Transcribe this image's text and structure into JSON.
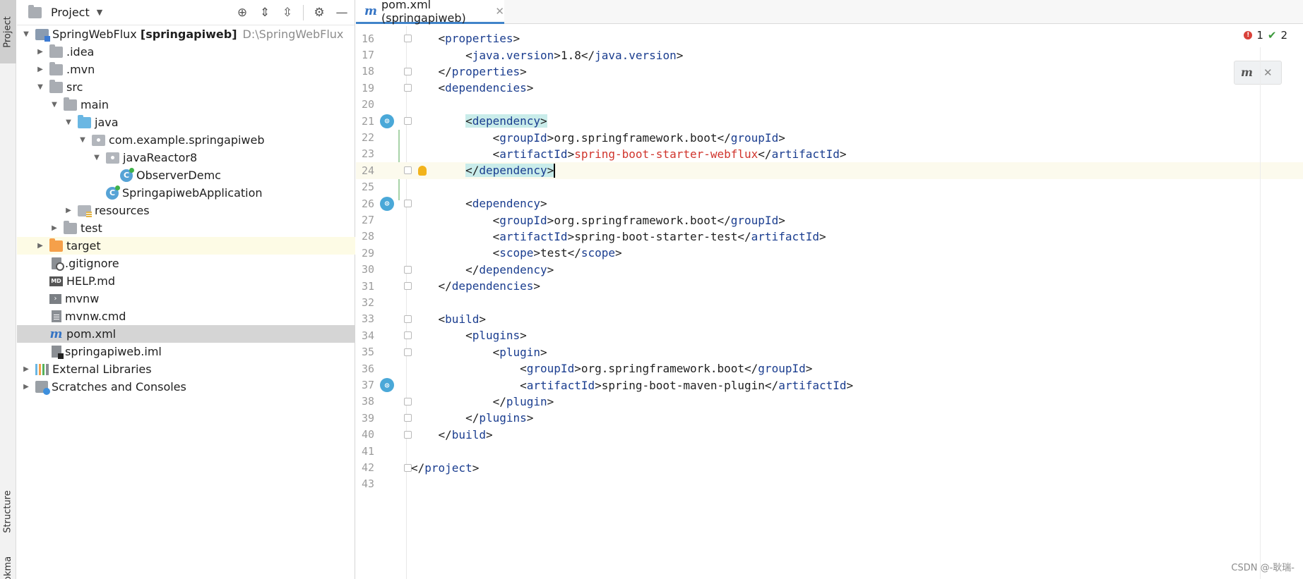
{
  "strip": {
    "project": "Project",
    "structure": "Structure",
    "bookmarks": "Bookmarks"
  },
  "project_panel": {
    "title": "Project",
    "tree": [
      {
        "label": "SpringWebFlux",
        "bold": "[springapiweb]",
        "path": "D:\\SpringWebFlux",
        "icon": "module-icon"
      },
      {
        "label": ".idea",
        "icon": "folder-icon"
      },
      {
        "label": ".mvn",
        "icon": "folder-icon"
      },
      {
        "label": "src",
        "icon": "folder-icon"
      },
      {
        "label": "main",
        "icon": "folder-icon"
      },
      {
        "label": "java",
        "icon": "source-folder-icon"
      },
      {
        "label": "com.example.springapiweb",
        "icon": "package-icon"
      },
      {
        "label": "javaReactor8",
        "icon": "package-icon"
      },
      {
        "label": "ObserverDemc",
        "icon": "class-icon"
      },
      {
        "label": "SpringapiwebApplication",
        "icon": "class-icon"
      },
      {
        "label": "resources",
        "icon": "resources-folder-icon"
      },
      {
        "label": "test",
        "icon": "folder-icon"
      },
      {
        "label": "target",
        "icon": "excluded-folder-icon"
      },
      {
        "label": ".gitignore",
        "icon": "ignore-file-icon"
      },
      {
        "label": "HELP.md",
        "icon": "markdown-icon",
        "badge": "MD"
      },
      {
        "label": "mvnw",
        "icon": "shell-icon"
      },
      {
        "label": "mvnw.cmd",
        "icon": "cmd-file-icon"
      },
      {
        "label": "pom.xml",
        "icon": "maven-icon"
      },
      {
        "label": "springapiweb.iml",
        "icon": "iml-icon"
      },
      {
        "label": "External Libraries",
        "icon": "libraries-icon"
      },
      {
        "label": "Scratches and Consoles",
        "icon": "scratches-icon"
      }
    ]
  },
  "editor": {
    "tab_label": "pom.xml (springapiweb)",
    "inspections": {
      "errors": "1",
      "warnings": "2"
    },
    "lines": [
      {
        "n": "16",
        "indent": "    ",
        "parts": [
          [
            "br",
            "<"
          ],
          [
            "tag",
            "properties"
          ],
          [
            "br",
            ">"
          ]
        ]
      },
      {
        "n": "17",
        "indent": "        ",
        "parts": [
          [
            "br",
            "<"
          ],
          [
            "tag",
            "java.version"
          ],
          [
            "br",
            ">"
          ],
          [
            "val",
            "1.8"
          ],
          [
            "br",
            "</"
          ],
          [
            "tag",
            "java.version"
          ],
          [
            "br",
            ">"
          ]
        ]
      },
      {
        "n": "18",
        "indent": "    ",
        "parts": [
          [
            "br",
            "</"
          ],
          [
            "tag",
            "properties"
          ],
          [
            "br",
            ">"
          ]
        ]
      },
      {
        "n": "19",
        "indent": "    ",
        "parts": [
          [
            "br",
            "<"
          ],
          [
            "tag",
            "dependencies"
          ],
          [
            "br",
            ">"
          ]
        ]
      },
      {
        "n": "20",
        "indent": "",
        "parts": []
      },
      {
        "n": "21",
        "indent": "        ",
        "parts": [
          [
            "hl-br",
            "<"
          ],
          [
            "hl-tag",
            "dependency"
          ],
          [
            "hl-br",
            ">"
          ]
        ]
      },
      {
        "n": "22",
        "indent": "            ",
        "parts": [
          [
            "br",
            "<"
          ],
          [
            "tag",
            "groupId"
          ],
          [
            "br",
            ">"
          ],
          [
            "val",
            "org.springframework.boot"
          ],
          [
            "br",
            "</"
          ],
          [
            "tag",
            "groupId"
          ],
          [
            "br",
            ">"
          ]
        ]
      },
      {
        "n": "23",
        "indent": "            ",
        "parts": [
          [
            "br",
            "<"
          ],
          [
            "tag",
            "artifactId"
          ],
          [
            "br",
            ">"
          ],
          [
            "err",
            "spring-boot-starter-webflux"
          ],
          [
            "br",
            "</"
          ],
          [
            "tag",
            "artifactId"
          ],
          [
            "br",
            ">"
          ]
        ]
      },
      {
        "n": "24",
        "indent": "        ",
        "parts": [
          [
            "hl-br",
            "</"
          ],
          [
            "hl-tag",
            "dependency"
          ],
          [
            "hl-br",
            ">"
          ]
        ]
      },
      {
        "n": "25",
        "indent": "",
        "parts": []
      },
      {
        "n": "26",
        "indent": "        ",
        "parts": [
          [
            "br",
            "<"
          ],
          [
            "tag",
            "dependency"
          ],
          [
            "br",
            ">"
          ]
        ]
      },
      {
        "n": "27",
        "indent": "            ",
        "parts": [
          [
            "br",
            "<"
          ],
          [
            "tag",
            "groupId"
          ],
          [
            "br",
            ">"
          ],
          [
            "val",
            "org.springframework.boot"
          ],
          [
            "br",
            "</"
          ],
          [
            "tag",
            "groupId"
          ],
          [
            "br",
            ">"
          ]
        ]
      },
      {
        "n": "28",
        "indent": "            ",
        "parts": [
          [
            "br",
            "<"
          ],
          [
            "tag",
            "artifactId"
          ],
          [
            "br",
            ">"
          ],
          [
            "val",
            "spring-boot-starter-test"
          ],
          [
            "br",
            "</"
          ],
          [
            "tag",
            "artifactId"
          ],
          [
            "br",
            ">"
          ]
        ]
      },
      {
        "n": "29",
        "indent": "            ",
        "parts": [
          [
            "br",
            "<"
          ],
          [
            "tag",
            "scope"
          ],
          [
            "br",
            ">"
          ],
          [
            "val",
            "test"
          ],
          [
            "br",
            "</"
          ],
          [
            "tag",
            "scope"
          ],
          [
            "br",
            ">"
          ]
        ]
      },
      {
        "n": "30",
        "indent": "        ",
        "parts": [
          [
            "br",
            "</"
          ],
          [
            "tag",
            "dependency"
          ],
          [
            "br",
            ">"
          ]
        ]
      },
      {
        "n": "31",
        "indent": "    ",
        "parts": [
          [
            "br",
            "</"
          ],
          [
            "tag",
            "dependencies"
          ],
          [
            "br",
            ">"
          ]
        ]
      },
      {
        "n": "32",
        "indent": "",
        "parts": []
      },
      {
        "n": "33",
        "indent": "    ",
        "parts": [
          [
            "br",
            "<"
          ],
          [
            "tag",
            "build"
          ],
          [
            "br",
            ">"
          ]
        ]
      },
      {
        "n": "34",
        "indent": "        ",
        "parts": [
          [
            "br",
            "<"
          ],
          [
            "tag",
            "plugins"
          ],
          [
            "br",
            ">"
          ]
        ]
      },
      {
        "n": "35",
        "indent": "            ",
        "parts": [
          [
            "br",
            "<"
          ],
          [
            "tag",
            "plugin"
          ],
          [
            "br",
            ">"
          ]
        ]
      },
      {
        "n": "36",
        "indent": "                ",
        "parts": [
          [
            "br",
            "<"
          ],
          [
            "tag",
            "groupId"
          ],
          [
            "br",
            ">"
          ],
          [
            "val",
            "org.springframework.boot"
          ],
          [
            "br",
            "</"
          ],
          [
            "tag",
            "groupId"
          ],
          [
            "br",
            ">"
          ]
        ]
      },
      {
        "n": "37",
        "indent": "                ",
        "parts": [
          [
            "br",
            "<"
          ],
          [
            "tag",
            "artifactId"
          ],
          [
            "br",
            ">"
          ],
          [
            "val",
            "spring-boot-maven-plugin"
          ],
          [
            "br",
            "</"
          ],
          [
            "tag",
            "artifactId"
          ],
          [
            "br",
            ">"
          ]
        ]
      },
      {
        "n": "38",
        "indent": "            ",
        "parts": [
          [
            "br",
            "</"
          ],
          [
            "tag",
            "plugin"
          ],
          [
            "br",
            ">"
          ]
        ]
      },
      {
        "n": "39",
        "indent": "        ",
        "parts": [
          [
            "br",
            "</"
          ],
          [
            "tag",
            "plugins"
          ],
          [
            "br",
            ">"
          ]
        ]
      },
      {
        "n": "40",
        "indent": "    ",
        "parts": [
          [
            "br",
            "</"
          ],
          [
            "tag",
            "build"
          ],
          [
            "br",
            ">"
          ]
        ]
      },
      {
        "n": "41",
        "indent": "",
        "parts": []
      },
      {
        "n": "42",
        "indent": "",
        "parts": [
          [
            "br",
            "</"
          ],
          [
            "tag",
            "project"
          ],
          [
            "br",
            ">"
          ]
        ]
      },
      {
        "n": "43",
        "indent": "",
        "parts": []
      }
    ]
  },
  "watermark": "CSDN @-耿瑞-",
  "colors": {
    "selection": "#d5d5d5",
    "tag": "#1a3d8f",
    "error": "#d0342c",
    "tab_accent": "#4083c9",
    "matched_tag_bg": "#c9ecea"
  }
}
